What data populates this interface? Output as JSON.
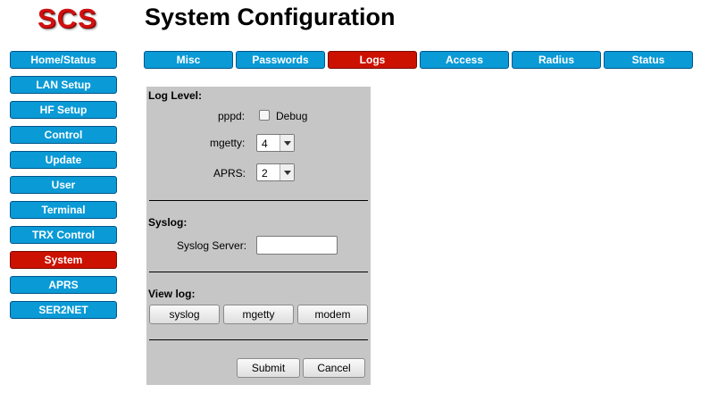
{
  "header": {
    "logo": "SCS",
    "title": "System Configuration"
  },
  "sidebar": {
    "items": [
      {
        "label": "Home/Status"
      },
      {
        "label": "LAN Setup"
      },
      {
        "label": "HF Setup"
      },
      {
        "label": "Control"
      },
      {
        "label": "Update"
      },
      {
        "label": "User"
      },
      {
        "label": "Terminal"
      },
      {
        "label": "TRX Control"
      },
      {
        "label": "System",
        "active": true
      },
      {
        "label": "APRS"
      },
      {
        "label": "SER2NET"
      }
    ]
  },
  "tabs": [
    {
      "label": "Misc"
    },
    {
      "label": "Passwords"
    },
    {
      "label": "Logs",
      "active": true
    },
    {
      "label": "Access"
    },
    {
      "label": "Radius"
    },
    {
      "label": "Status"
    }
  ],
  "colors": {
    "nav_blue": "#0a9ad6",
    "active_red": "#cc1100",
    "panel_gray": "#c6c6c6"
  },
  "panel": {
    "log_level": {
      "heading": "Log Level:",
      "pppd_label": "pppd:",
      "pppd_checkbox_label": "Debug",
      "pppd_checked": false,
      "mgetty_label": "mgetty:",
      "mgetty_value": "4",
      "aprs_label": "APRS:",
      "aprs_value": "2"
    },
    "syslog": {
      "heading": "Syslog:",
      "server_label": "Syslog Server:",
      "server_value": ""
    },
    "view_log": {
      "heading": "View log:",
      "buttons": [
        "syslog",
        "mgetty",
        "modem"
      ]
    },
    "actions": {
      "submit": "Submit",
      "cancel": "Cancel"
    }
  }
}
